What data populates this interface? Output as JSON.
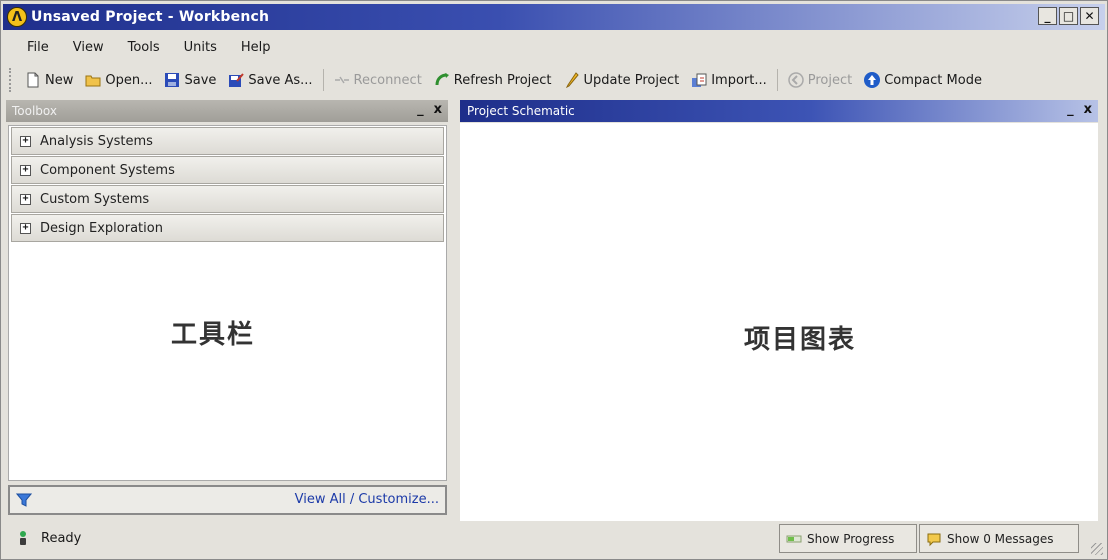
{
  "window": {
    "title": "Unsaved Project - Workbench",
    "logo_glyph": "Λ",
    "controls": {
      "minimize": "_",
      "maximize": "□",
      "close": "✕"
    }
  },
  "menu": [
    "File",
    "View",
    "Tools",
    "Units",
    "Help"
  ],
  "toolbar": {
    "new": "New",
    "open": "Open...",
    "save": "Save",
    "save_as": "Save As...",
    "reconnect": "Reconnect",
    "refresh_project": "Refresh Project",
    "update_project": "Update Project",
    "import": "Import...",
    "project": "Project",
    "compact_mode": "Compact Mode"
  },
  "toolbox": {
    "title": "Toolbox",
    "minimize": "_",
    "close": "x",
    "categories": [
      {
        "label": "Analysis Systems",
        "expander": "+"
      },
      {
        "label": "Component Systems",
        "expander": "+"
      },
      {
        "label": "Custom Systems",
        "expander": "+"
      },
      {
        "label": "Design Exploration",
        "expander": "+"
      }
    ],
    "overlay_label": "工具栏",
    "footer_link": "View All / Customize..."
  },
  "schematic": {
    "title": "Project Schematic",
    "minimize": "_",
    "close": "x",
    "overlay_label": "项目图表"
  },
  "status": {
    "text": "Ready",
    "show_progress": "Show Progress",
    "show_messages": "Show 0 Messages"
  },
  "colors": {
    "title_bar": "#1f2f8c",
    "link": "#1c3aa8",
    "logo": "#f3c019"
  },
  "icons": [
    "new-icon",
    "open-folder-icon",
    "save-icon",
    "save-as-icon",
    "reconnect-icon",
    "refresh-icon",
    "update-icon",
    "import-icon",
    "project-back-icon",
    "compact-mode-icon",
    "filter-icon",
    "status-light-icon",
    "progress-icon",
    "messages-icon"
  ]
}
